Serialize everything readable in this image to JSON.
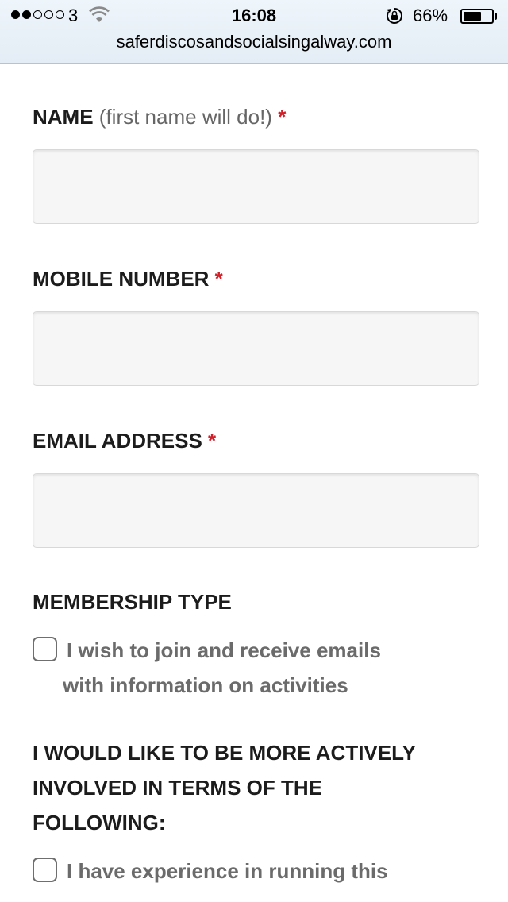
{
  "status_bar": {
    "carrier": "3",
    "time": "16:08",
    "battery_percent": "66%",
    "battery_level": 0.66,
    "signal_bars_filled": 2,
    "signal_bars_total": 5
  },
  "browser": {
    "url": "saferdiscosandsocialsingalway.com"
  },
  "form": {
    "name": {
      "label": "NAME",
      "hint": "(first name will do!)",
      "required_mark": "*",
      "value": ""
    },
    "mobile": {
      "label": "MOBILE NUMBER",
      "required_mark": "*",
      "value": ""
    },
    "email": {
      "label": "EMAIL ADDRESS",
      "required_mark": "*",
      "value": ""
    },
    "membership": {
      "heading": "MEMBERSHIP TYPE",
      "option_line1": "I wish to join and receive emails",
      "option_line2": "with information on activities",
      "checked": false
    },
    "involvement": {
      "heading_line1": "I WOULD LIKE TO BE MORE ACTIVELY",
      "heading_line2": "INVOLVED IN TERMS OF THE",
      "heading_line3": "FOLLOWING:",
      "option_line1": "I have experience in running this",
      "checked": false
    }
  },
  "colors": {
    "required": "#d0202a",
    "label": "#1c1c1c",
    "checkbox_text": "#6b6b6b",
    "field_bg": "#f6f6f6"
  }
}
